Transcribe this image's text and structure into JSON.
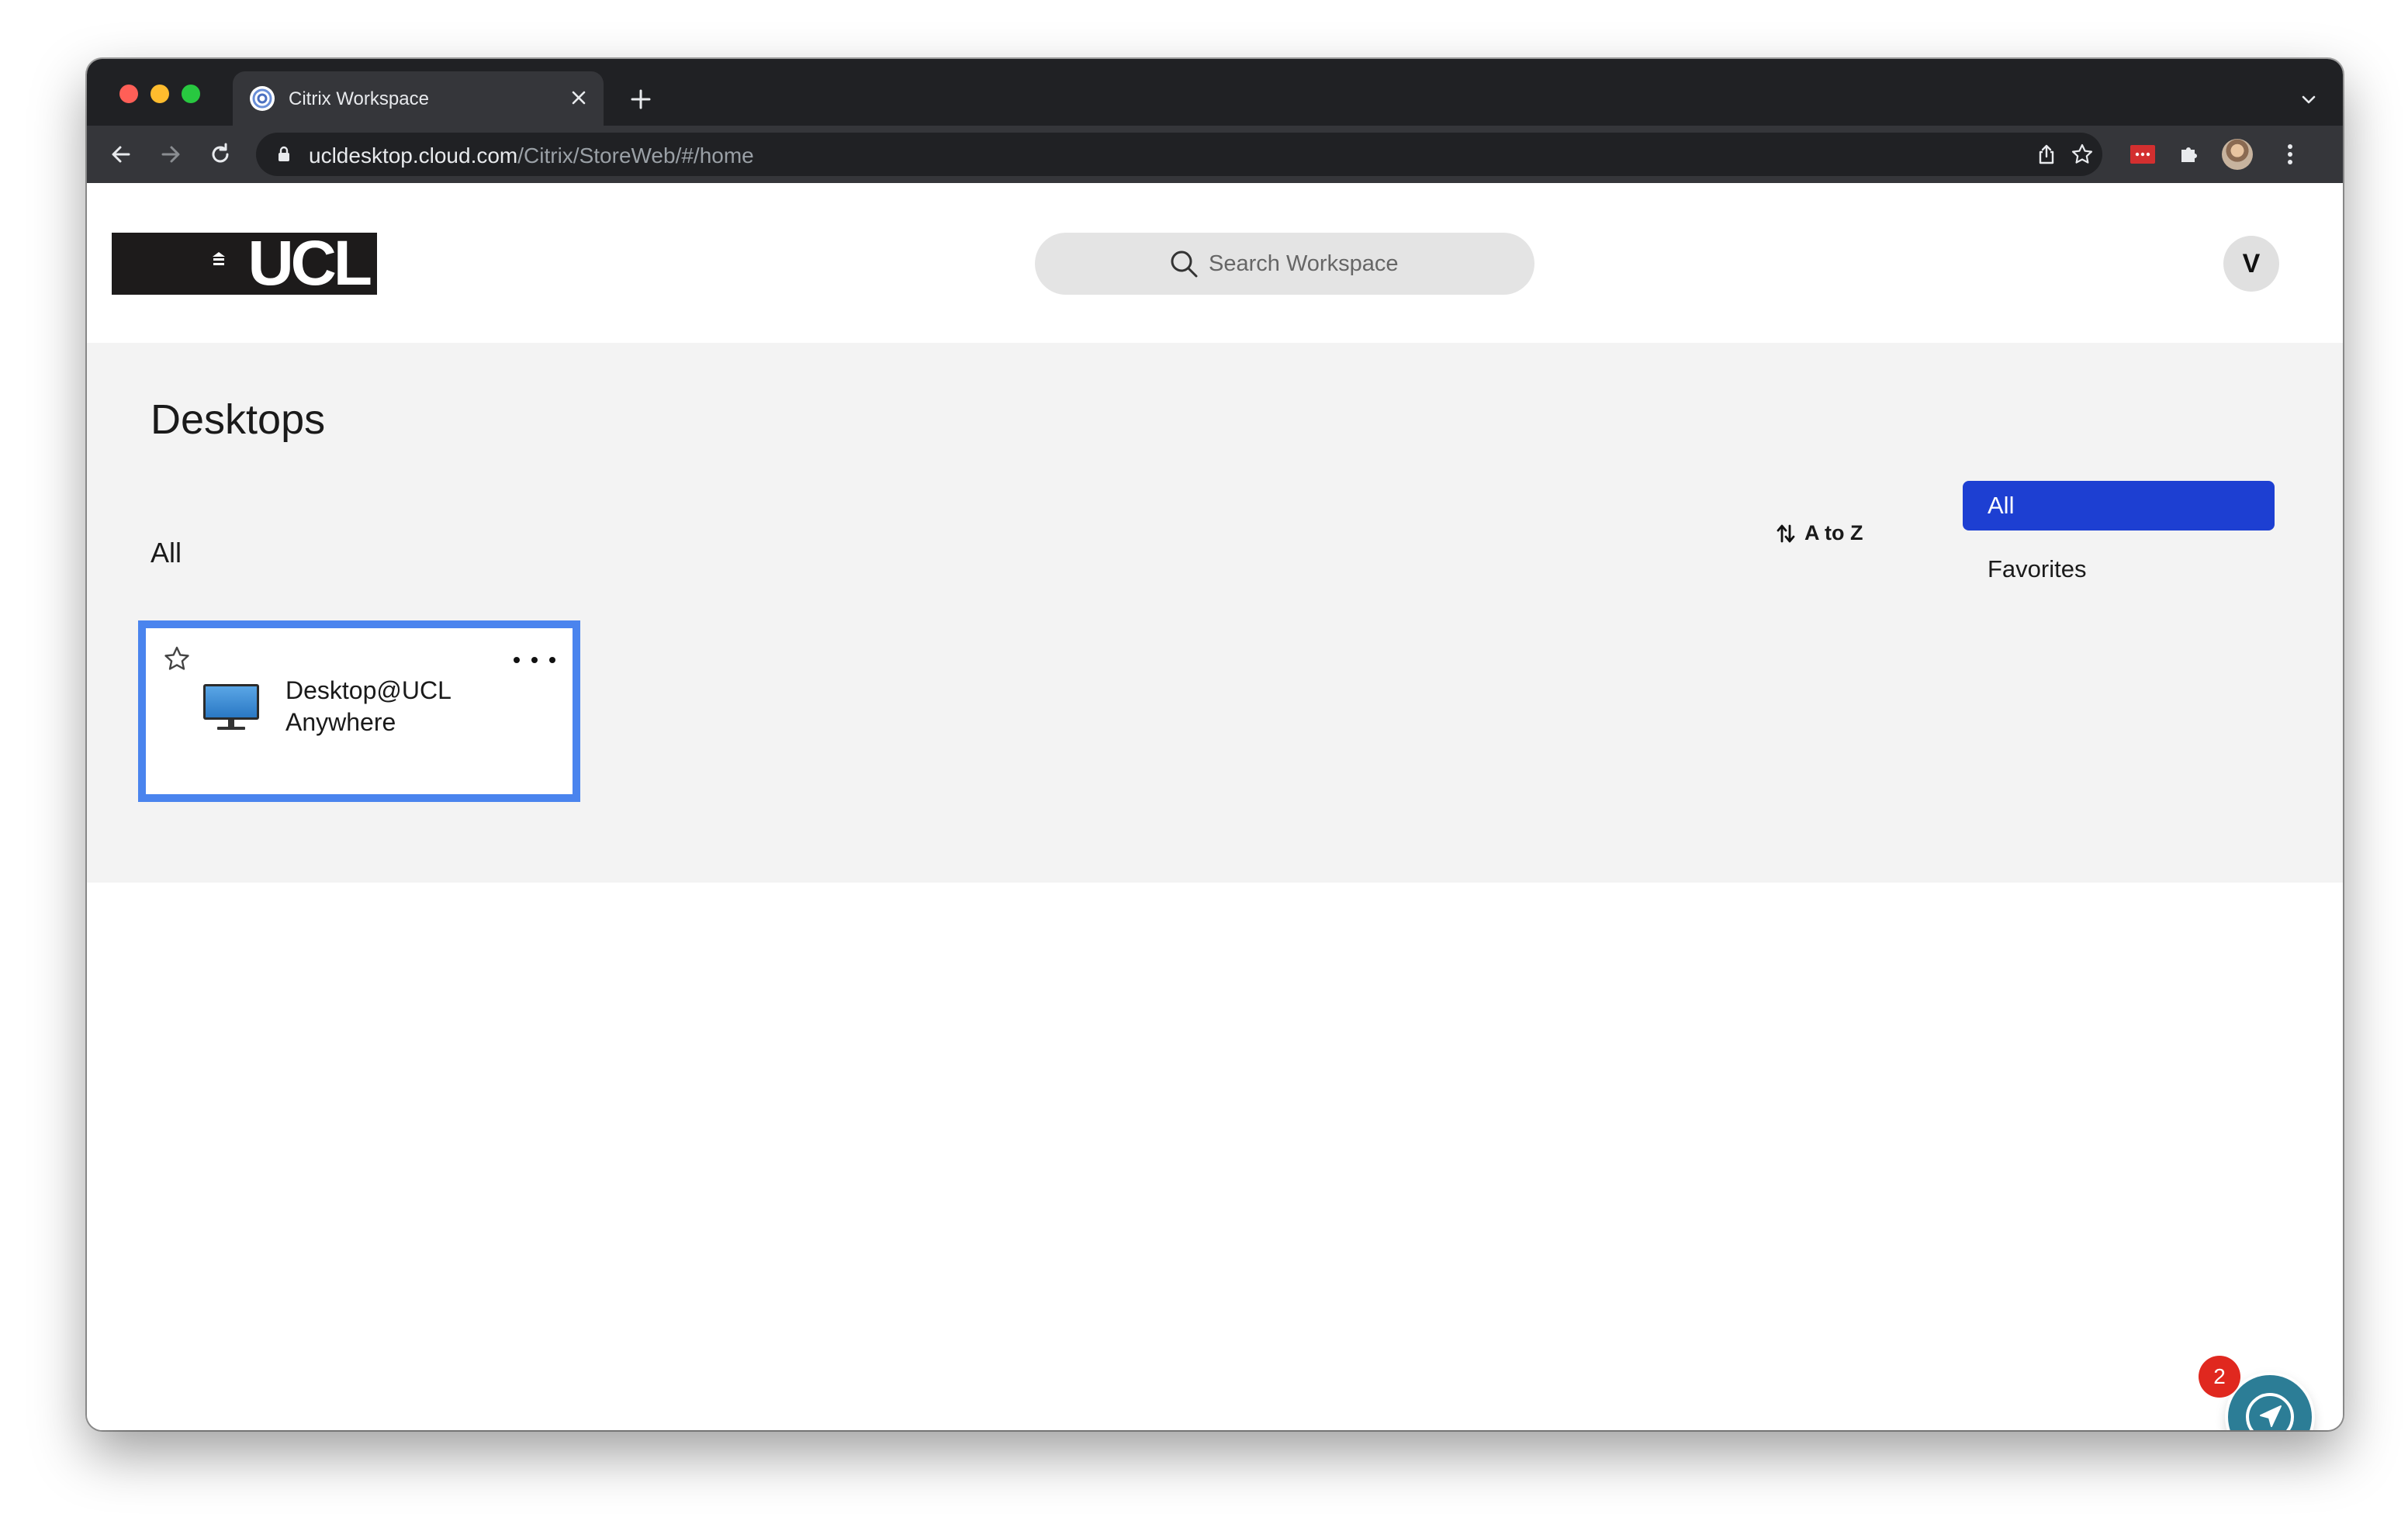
{
  "browser": {
    "tab_title": "Citrix Workspace",
    "url_host": "ucldesktop.cloud.com",
    "url_path": "/Citrix/StoreWeb/#/home"
  },
  "header": {
    "logo_text": "UCL",
    "search_placeholder": "Search Workspace",
    "user_initial": "V"
  },
  "main": {
    "title": "Desktops",
    "section_label": "All",
    "sort_label": "A to Z",
    "filters": [
      "All",
      "Favorites"
    ],
    "selected_filter": "All",
    "desktops": [
      {
        "name_line1": "Desktop@UCL",
        "name_line2": "Anywhere"
      }
    ]
  },
  "notification": {
    "count": "2"
  },
  "colors": {
    "accent": "#1d3fd2",
    "card_focus": "#4a84ee",
    "fab": "#2c7d96",
    "badge": "#e0281f"
  }
}
